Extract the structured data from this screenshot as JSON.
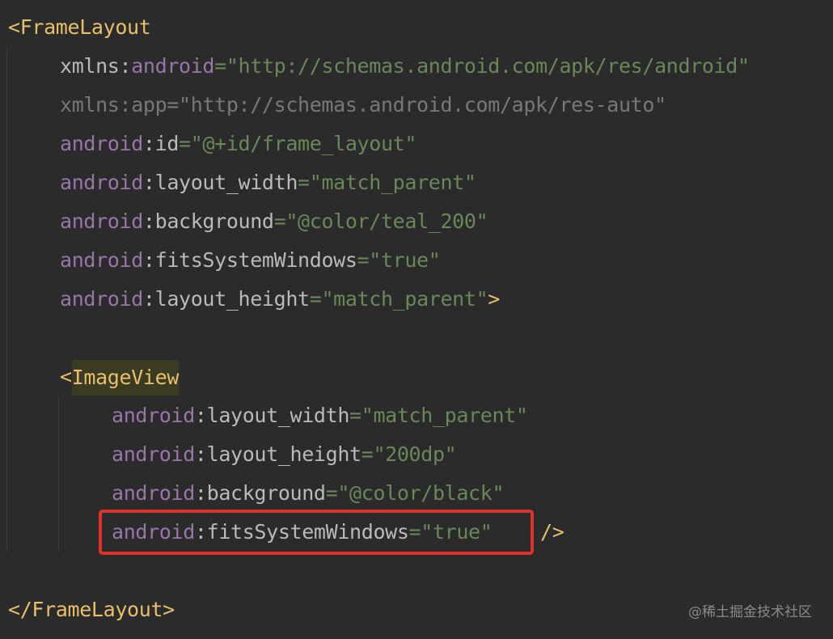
{
  "code": {
    "open_tag": "FrameLayout",
    "attributes": [
      {
        "ns": "xmlns",
        "name": "android",
        "value": "\"http://schemas.android.com/apk/res/android\""
      },
      {
        "text": "xmlns:app=\"http://schemas.android.com/apk/res-auto\""
      },
      {
        "ns": "android",
        "name": "id",
        "value": "\"@+id/frame_layout\""
      },
      {
        "ns": "android",
        "name": "layout_width",
        "value": "\"match_parent\""
      },
      {
        "ns": "android",
        "name": "background",
        "value": "\"@color/teal_200\""
      },
      {
        "ns": "android",
        "name": "fitsSystemWindows",
        "value": "\"true\""
      },
      {
        "ns": "android",
        "name": "layout_height",
        "value": "\"match_parent\""
      }
    ],
    "child_tag": "ImageView",
    "child_attributes": [
      {
        "ns": "android",
        "name": "layout_width",
        "value": "\"match_parent\""
      },
      {
        "ns": "android",
        "name": "layout_height",
        "value": "\"200dp\""
      },
      {
        "ns": "android",
        "name": "background",
        "value": "\"@color/black\""
      },
      {
        "ns": "android",
        "name": "fitsSystemWindows",
        "value": "\"true\""
      }
    ],
    "close_tag": "FrameLayout",
    "lt": "<",
    "gt": ">",
    "close_lt": "</",
    "self_close": "/>",
    "colon": ":",
    "eq": "="
  },
  "watermark": "@稀土掘金技术社区",
  "colors": {
    "background": "#2b2b2b",
    "tag": "#e8bf6a",
    "namespace": "#9876aa",
    "attribute": "#bababa",
    "string": "#6a8759",
    "highlight_box": "#e0322c"
  }
}
